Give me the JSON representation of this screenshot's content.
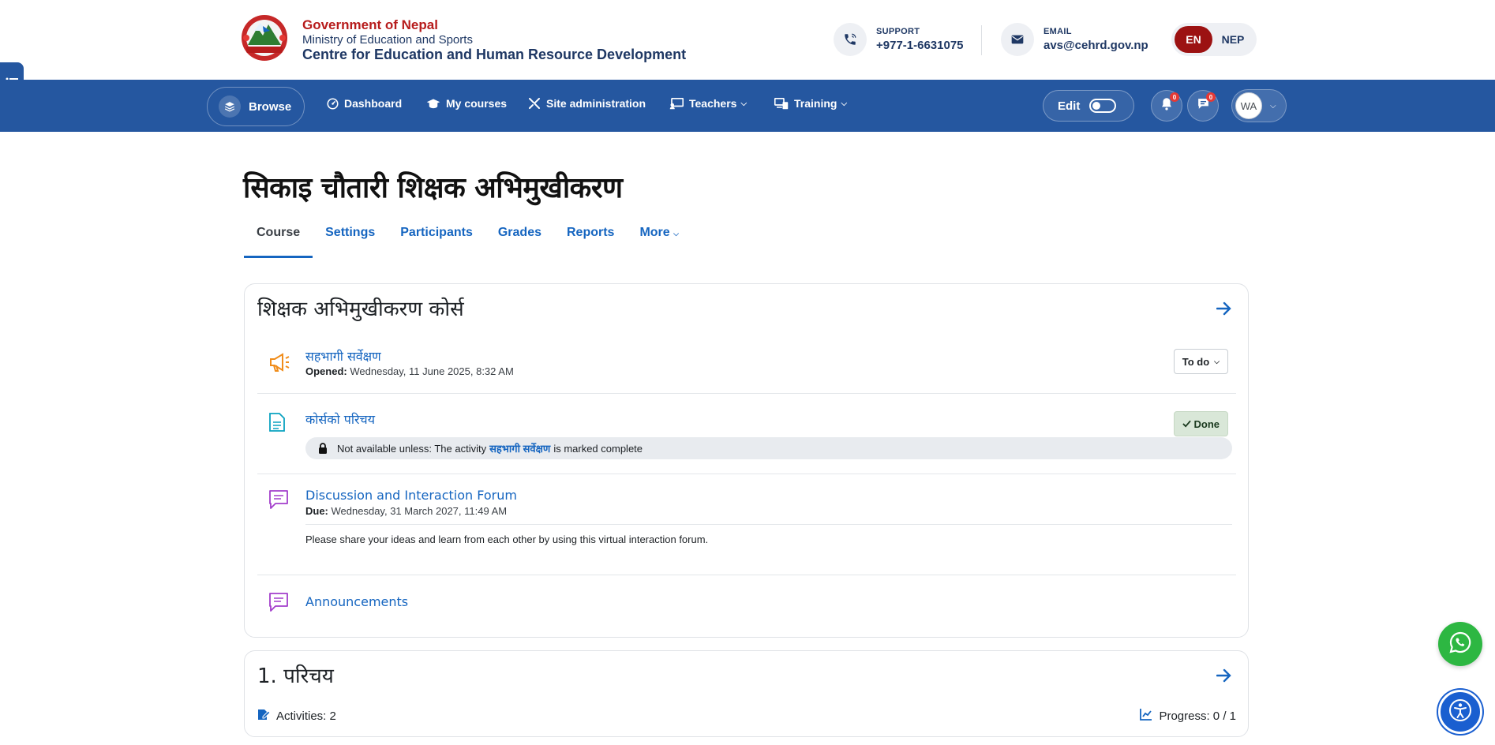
{
  "header": {
    "gov_title": "Government of Nepal",
    "ministry": "Ministry of Education and Sports",
    "centre": "Centre for Education and Human Resource Development",
    "support": {
      "label": "SUPPORT",
      "value": "+977-1-6631075"
    },
    "email": {
      "label": "EMAIL",
      "value": "avs@cehrd.gov.np"
    },
    "languages": {
      "active": "EN",
      "other": "NEP"
    }
  },
  "navbar": {
    "browse": "Browse",
    "items": [
      {
        "label": "Dashboard",
        "icon": "dashboard-icon"
      },
      {
        "label": "My courses",
        "icon": "graduation-cap-icon"
      },
      {
        "label": "Site administration",
        "icon": "tools-icon"
      },
      {
        "label": "Teachers",
        "icon": "chalkboard-icon",
        "has_dropdown": true
      },
      {
        "label": "Training",
        "icon": "devices-icon",
        "has_dropdown": true
      }
    ],
    "edit_label": "Edit",
    "notifications_count": "0",
    "messages_count": "0",
    "user_initials": "WA"
  },
  "page": {
    "title": "सिकाइ चौतारी शिक्षक अभिमुखीकरण",
    "tabs": [
      "Course",
      "Settings",
      "Participants",
      "Grades",
      "Reports",
      "More"
    ],
    "active_tab": "Course"
  },
  "sections": [
    {
      "title": "शिक्षक अभिमुखीकरण कोर्स",
      "activities": [
        {
          "name": "सहभागी सर्वेक्षण",
          "meta_label": "Opened:",
          "meta_value": "Wednesday, 11 June 2025, 8:32 AM",
          "status": "To do"
        },
        {
          "name": "कोर्सको परिचय",
          "status": "Done",
          "restriction": {
            "prefix": "Not available unless: The activity",
            "link": "सहभागी सर्वेक्षण",
            "suffix": "is marked complete"
          }
        },
        {
          "name": "Discussion and Interaction Forum",
          "meta_label": "Due:",
          "meta_value": "Wednesday, 31 March 2027, 11:49 AM",
          "description": "Please share your ideas and learn from each other by using this virtual interaction forum."
        },
        {
          "name": "Announcements"
        }
      ]
    },
    {
      "title": "1. परिचय",
      "activities_label": "Activities: 2",
      "progress_label": "Progress: 0 / 1"
    }
  ],
  "colors": {
    "brand_blue": "#2557a0",
    "link_blue": "#1565c0",
    "gov_red": "#b71c1c",
    "lang_active": "#9c1212",
    "whatsapp_green": "#2db742",
    "done_bg": "#d9e7d8"
  }
}
